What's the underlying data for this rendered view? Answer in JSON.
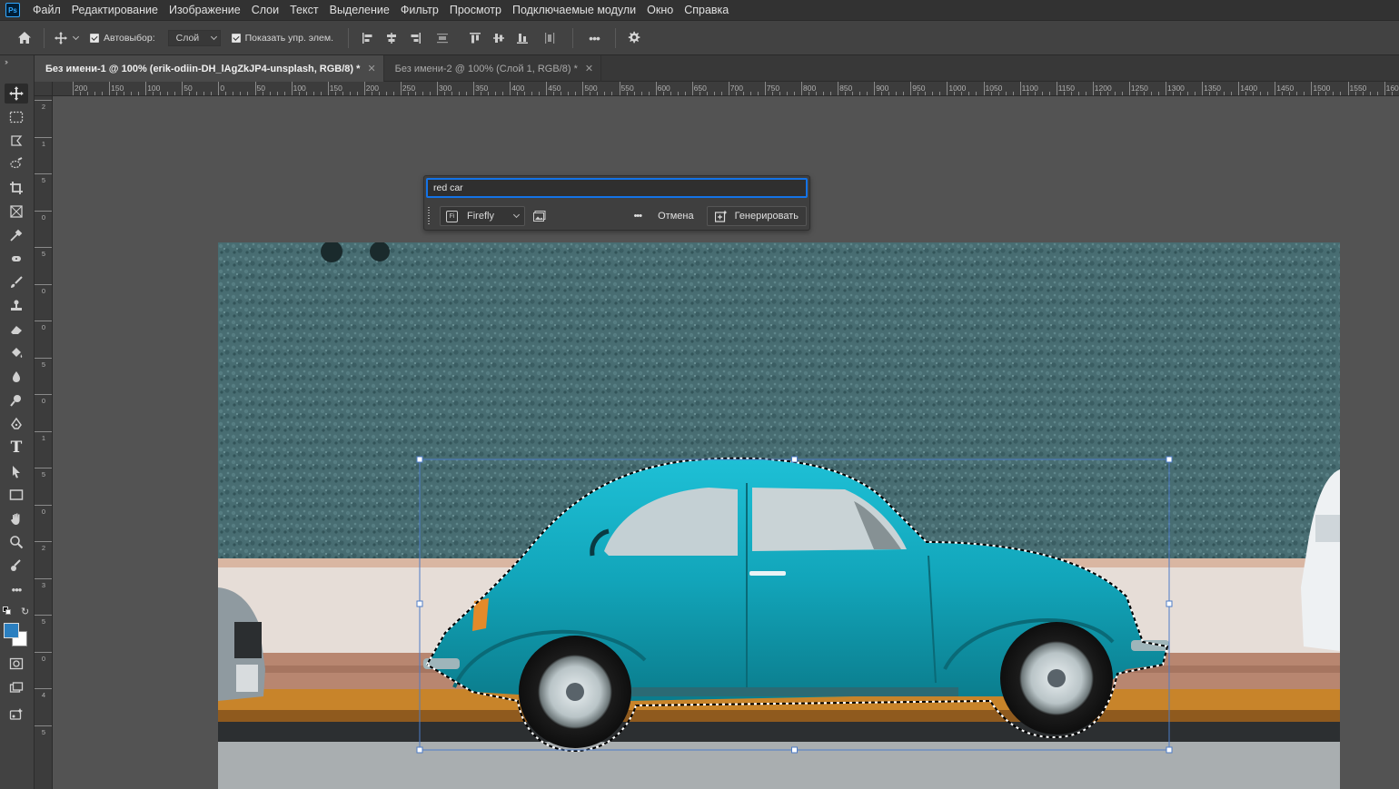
{
  "app": {
    "logo": "Ps",
    "menu": [
      "Файл",
      "Редактирование",
      "Изображение",
      "Слои",
      "Текст",
      "Выделение",
      "Фильтр",
      "Просмотр",
      "Подключаемые модули",
      "Окно",
      "Справка"
    ]
  },
  "options_bar": {
    "autoselect_label": "Автовыбор:",
    "autoselect_checked": true,
    "autoselect_target": "Слой",
    "show_transform_label": "Показать упр. элем.",
    "show_transform_checked": true,
    "more_label": "•••"
  },
  "tabs": [
    {
      "title": "Без имени-1 @ 100% (erik-odiin-DH_lAgZkJP4-unsplash, RGB/8) *",
      "active": true
    },
    {
      "title": "Без имени-2 @ 100% (Слой 1, RGB/8) *",
      "active": false
    }
  ],
  "ruler": {
    "top_labels": [
      "200",
      "150",
      "100",
      "50",
      "0",
      "50",
      "100",
      "150",
      "200",
      "250",
      "300",
      "350",
      "400",
      "450",
      "500",
      "550",
      "600",
      "650",
      "700",
      "750",
      "800",
      "850",
      "900",
      "950",
      "1000",
      "1050",
      "1100",
      "1150",
      "1200",
      "1250",
      "1300",
      "1350",
      "1400",
      "1450",
      "1500",
      "1550",
      "1600"
    ],
    "left_labels": [
      "2",
      "1",
      "5",
      "0",
      "5",
      "0",
      "0",
      "5",
      "0",
      "1",
      "5",
      "0",
      "2",
      "3",
      "5",
      "0",
      "4",
      "5"
    ]
  },
  "generative_fill": {
    "prompt_value": "red car",
    "model_label": "Firefly",
    "model_icon_text": "Fi",
    "more_label": "•••",
    "cancel_label": "Отмена",
    "generate_label": "Генерировать"
  },
  "colors": {
    "accent": "#1473e6",
    "foreground_swatch": "#2b7fc0",
    "background_swatch": "#ffffff",
    "car": "#14a3b8",
    "wall": "#4a6e73"
  }
}
